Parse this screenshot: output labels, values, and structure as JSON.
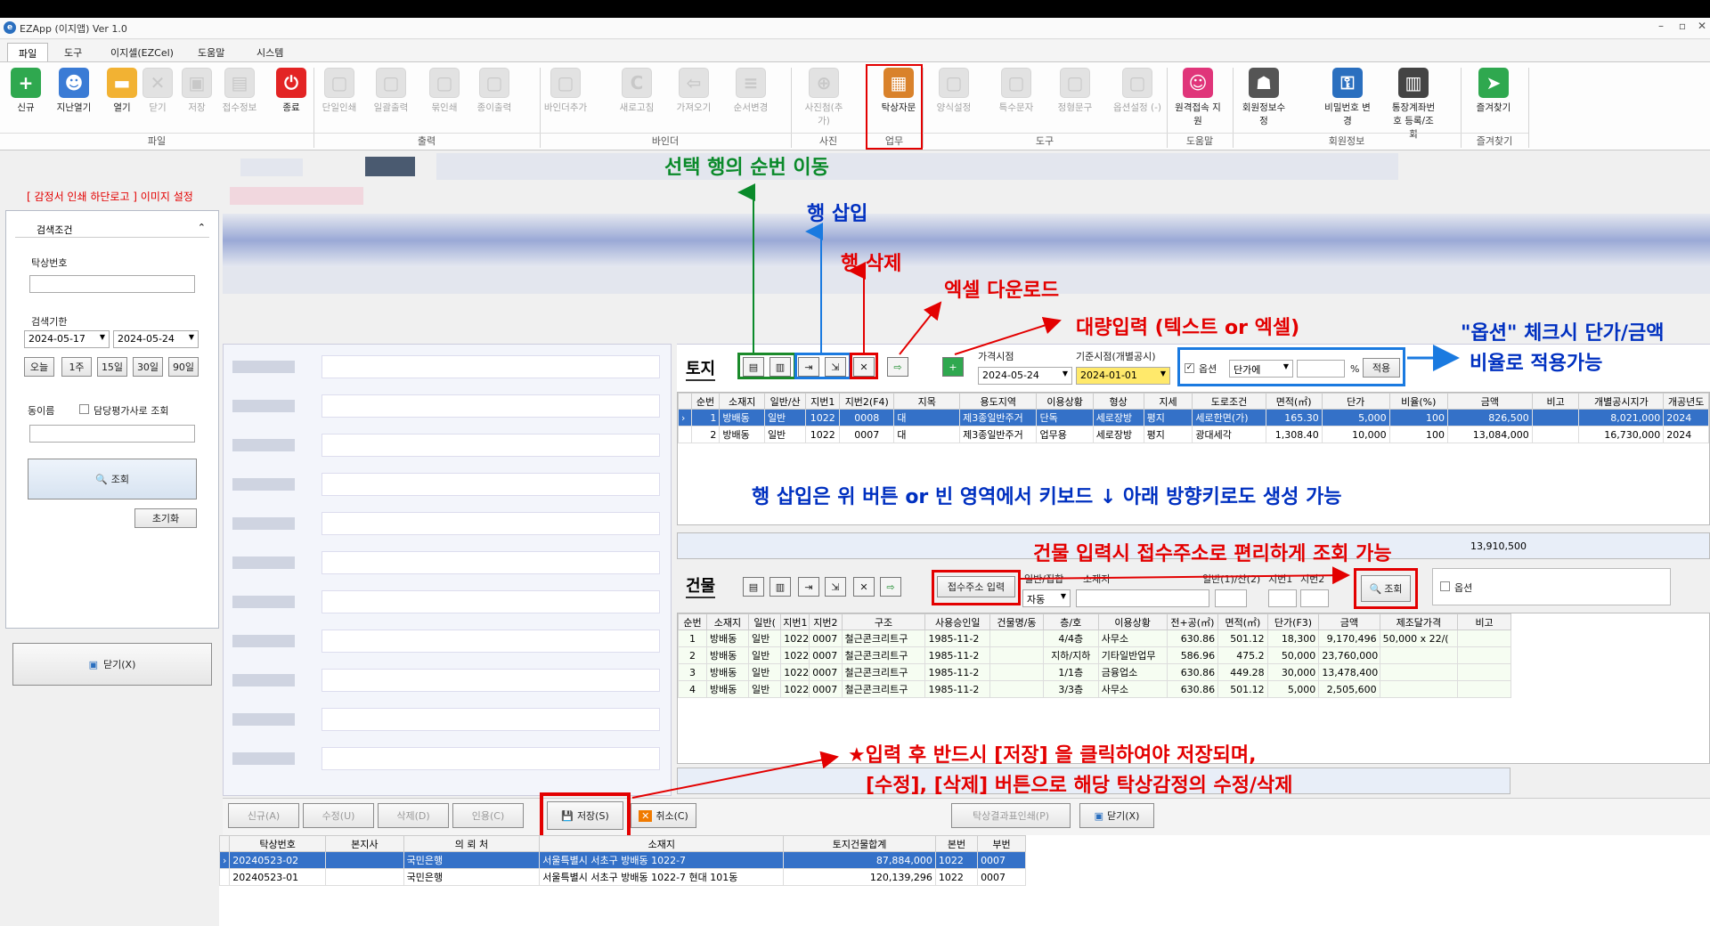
{
  "app": {
    "title": "EZApp (이지앱)  Ver 1.0"
  },
  "menu": [
    "파일",
    "도구",
    "이지셀(EZCel)",
    "도움말",
    "시스템"
  ],
  "ribbon": {
    "buttons": [
      {
        "label": "신규",
        "icon": "plus-icon",
        "color": "#2fa84f"
      },
      {
        "label": "지난열기",
        "icon": "users-icon",
        "color": "#3a7bd5"
      },
      {
        "label": "열기",
        "icon": "folder-icon",
        "color": "#f2b233"
      },
      {
        "label": "닫기",
        "icon": "close-icon",
        "color": ""
      },
      {
        "label": "저장",
        "icon": "save-icon",
        "color": ""
      },
      {
        "label": "접수정보",
        "icon": "document-icon",
        "color": ""
      },
      {
        "label": "종료",
        "icon": "power-icon",
        "color": "#e32424"
      },
      {
        "label": "단일인쇄",
        "icon": "print-icon",
        "color": ""
      },
      {
        "label": "일괄출력",
        "icon": "print-batch-icon",
        "color": ""
      },
      {
        "label": "묶인쇄",
        "icon": "print-bundle-icon",
        "color": ""
      },
      {
        "label": "종이출력",
        "icon": "paper-print-icon",
        "color": ""
      },
      {
        "label": "바인더추가",
        "icon": "binder-add-icon",
        "color": ""
      },
      {
        "label": "새로고침",
        "icon": "refresh-icon",
        "color": ""
      },
      {
        "label": "가져오기",
        "icon": "import-icon",
        "color": ""
      },
      {
        "label": "순서변경",
        "icon": "reorder-icon",
        "color": ""
      },
      {
        "label": "사진첨(추가)",
        "icon": "photo-add-icon",
        "color": ""
      },
      {
        "label": "탁상자문",
        "icon": "desk-icon",
        "color": "#d9822b"
      },
      {
        "label": "양식설정",
        "icon": "form-settings-icon",
        "color": ""
      },
      {
        "label": "특수문자",
        "icon": "special-char-icon",
        "color": ""
      },
      {
        "label": "정형문구",
        "icon": "phrase-icon",
        "color": ""
      },
      {
        "label": "옵션설정 (-)",
        "icon": "option-settings-icon",
        "color": ""
      },
      {
        "label": "원격접속 지원",
        "icon": "remote-support-icon",
        "color": "#e0357a"
      },
      {
        "label": "회원정보수정",
        "icon": "member-edit-icon",
        "color": "#555555"
      },
      {
        "label": "비밀번호 변경",
        "icon": "password-icon",
        "color": "#2a6fbf"
      },
      {
        "label": "통장계좌번호 등록/조회",
        "icon": "bank-account-icon",
        "color": "#444444"
      },
      {
        "label": "즐겨찾기",
        "icon": "favorites-icon",
        "color": "#2fa84f"
      }
    ],
    "groups": [
      "파일",
      "출력",
      "바인더",
      "사진",
      "업무",
      "도구",
      "도움말",
      "회원정보",
      "즐겨찾기"
    ]
  },
  "notice": "[ 감정서 인쇄 하단로고 ] 이미지 설정",
  "search": {
    "header": "검색조건",
    "no_label": "탁상번호",
    "period_label": "검색기한",
    "date_from": "2024-05-17",
    "date_to": "2024-05-24",
    "quick": [
      "오늘",
      "1주",
      "15일",
      "30일",
      "90일"
    ],
    "name_label": "동이름",
    "check_label": "담당평가사로 조회",
    "search_btn": "조회",
    "reset_btn": "초기화",
    "close_btn": "닫기(X)"
  },
  "land": {
    "title": "토지",
    "price_label": "가격시점",
    "price_date": "2024-05-24",
    "base_label": "기준시점(개별공시)",
    "base_date": "2024-01-01",
    "option_label": "옵션",
    "option_select": "단가에",
    "pct": "%",
    "apply": "적용",
    "columns": [
      "순번",
      "소재지",
      "일반/산",
      "지번1",
      "지번2(F4)",
      "지목",
      "용도지역",
      "이용상황",
      "형상",
      "지세",
      "도로조건",
      "면적(㎡)",
      "단가",
      "비율(%)",
      "금액",
      "비고",
      "개별공시지가",
      "개공년도"
    ],
    "rows": [
      [
        "1",
        "방배동",
        "일반",
        "1022",
        "0008",
        "대",
        "제3종일반주거",
        "단독",
        "세로장방",
        "평지",
        "세로한면(가)",
        "165.30",
        "5,000",
        "100",
        "826,500",
        "",
        "8,021,000",
        "2024"
      ],
      [
        "2",
        "방배동",
        "일반",
        "1022",
        "0007",
        "대",
        "제3종일반주거",
        "업무용",
        "세로장방",
        "평지",
        "광대세각",
        "1,308.40",
        "10,000",
        "100",
        "13,084,000",
        "",
        "16,730,000",
        "2024"
      ]
    ],
    "total": "13,910,500"
  },
  "building": {
    "title": "건물",
    "addr_btn": "접수주소 입력",
    "lbl_kind": "일반/집합",
    "lbl_loc": "소재지",
    "lbl_gen": "일반(1)/산(2)",
    "lbl_j1": "지번1",
    "lbl_j2": "지번2",
    "auto": "자동",
    "search_btn": "조회",
    "option_label": "옵션",
    "columns": [
      "순번",
      "소재지",
      "일반(",
      "지번1",
      "지번2",
      "구조",
      "사용승인일",
      "건물명/동",
      "층/호",
      "이용상황",
      "전+공(㎡)",
      "면적(㎡)",
      "단가(F3)",
      "금액",
      "제조달가격",
      "비고"
    ],
    "rows": [
      [
        "1",
        "방배동",
        "일반",
        "1022",
        "0007",
        "철근콘크리트구",
        "1985-11-2",
        "",
        "4/4층",
        "사무소",
        "630.86",
        "501.12",
        "18,300",
        "9,170,496",
        "50,000 x 22/(",
        ""
      ],
      [
        "2",
        "방배동",
        "일반",
        "1022",
        "0007",
        "철근콘크리트구",
        "1985-11-2",
        "",
        "지하/지하",
        "기타일반업무",
        "586.96",
        "475.2",
        "50,000",
        "23,760,000",
        "",
        ""
      ],
      [
        "3",
        "방배동",
        "일반",
        "1022",
        "0007",
        "철근콘크리트구",
        "1985-11-2",
        "",
        "1/1층",
        "금융업소",
        "630.86",
        "449.28",
        "30,000",
        "13,478,400",
        "",
        ""
      ],
      [
        "4",
        "방배동",
        "일반",
        "1022",
        "0007",
        "철근콘크리트구",
        "1985-11-2",
        "",
        "3/3층",
        "사무소",
        "630.86",
        "501.12",
        "5,000",
        "2,505,600",
        "",
        ""
      ]
    ]
  },
  "bottom_bar": {
    "new": "신규(A)",
    "edit": "수정(U)",
    "delete": "삭제(D)",
    "quote": "인용(C)",
    "save": "저장(S)",
    "cancel": "취소(C)",
    "print": "탁상결과표인쇄(P)",
    "close": "닫기(X)"
  },
  "list": {
    "columns": [
      "탁상번호",
      "본지사",
      "의 뢰 처",
      "소재지",
      "토지건물합계",
      "본번",
      "부번"
    ],
    "rows": [
      [
        "20240523-02",
        "",
        "국민은행",
        "서울특별시 서초구 방배동 1022-7",
        "87,884,000",
        "1022",
        "0007"
      ],
      [
        "20240523-01",
        "",
        "국민은행",
        "서울특별시 서초구 방배동 1022-7 현대 101동",
        "120,139,296",
        "1022",
        "0007"
      ]
    ]
  },
  "annotations": {
    "move": "선택 행의 순번 이동",
    "insert": "행 삽입",
    "delete": "행 삭제",
    "excel": "엑셀 다운로드",
    "bulk": "대량입력 (텍스트 or 엑셀)",
    "option1": "\"옵션\" 체크시 단가/금액",
    "option2": "비율로 적용가능",
    "rowtip": "행 삽입은 위 버튼 or 빈 영역에서 키보드 ↓ 아래 방향키로도 생성 가능",
    "addrtip": "건물 입력시 접수주소로 편리하게 조회 가능",
    "save1": "★입력 후 반드시 [저장] 을 클릭하여야 저장되며,",
    "save2": "[수정], [삭제] 버튼으로 해당 탁상감정의 수정/삭제"
  },
  "colors": {
    "annotation_red": "#e30000",
    "annotation_blue": "#0030c0",
    "annotation_green": "#0a8a2a",
    "selected_row": "#3471c8",
    "accent_yellow": "#ffe96b"
  }
}
